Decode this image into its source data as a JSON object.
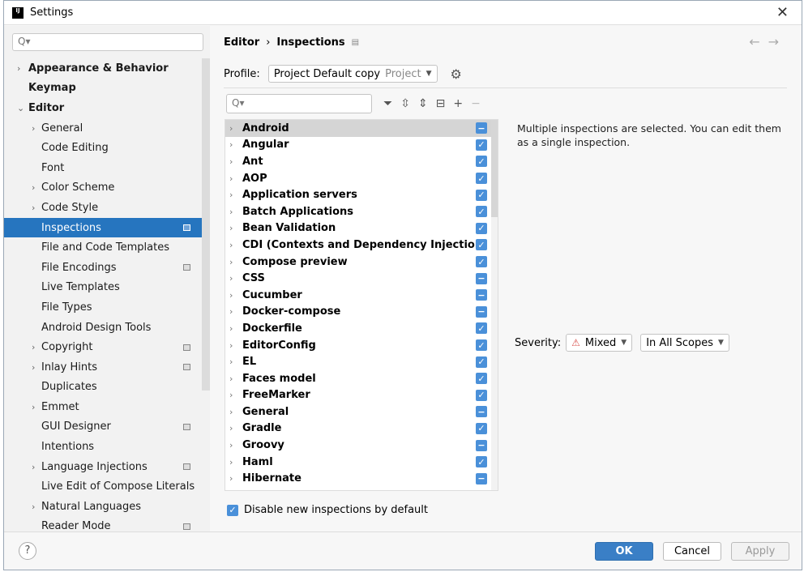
{
  "window": {
    "title": "Settings"
  },
  "sidebar": {
    "search_placeholder": "Q▾",
    "items": [
      {
        "label": "Appearance & Behavior",
        "level": 0,
        "arrow": "›",
        "bold": true
      },
      {
        "label": "Keymap",
        "level": 0,
        "arrow": "",
        "bold": true
      },
      {
        "label": "Editor",
        "level": 0,
        "arrow": "⌄",
        "bold": true
      },
      {
        "label": "General",
        "level": 1,
        "arrow": "›"
      },
      {
        "label": "Code Editing",
        "level": 1,
        "arrow": ""
      },
      {
        "label": "Font",
        "level": 1,
        "arrow": ""
      },
      {
        "label": "Color Scheme",
        "level": 1,
        "arrow": "›"
      },
      {
        "label": "Code Style",
        "level": 1,
        "arrow": "›"
      },
      {
        "label": "Inspections",
        "level": 1,
        "arrow": "",
        "selected": true,
        "cfg": true
      },
      {
        "label": "File and Code Templates",
        "level": 1,
        "arrow": ""
      },
      {
        "label": "File Encodings",
        "level": 1,
        "arrow": "",
        "cfg": true
      },
      {
        "label": "Live Templates",
        "level": 1,
        "arrow": ""
      },
      {
        "label": "File Types",
        "level": 1,
        "arrow": ""
      },
      {
        "label": "Android Design Tools",
        "level": 1,
        "arrow": ""
      },
      {
        "label": "Copyright",
        "level": 1,
        "arrow": "›",
        "cfg": true
      },
      {
        "label": "Inlay Hints",
        "level": 1,
        "arrow": "›",
        "cfg": true
      },
      {
        "label": "Duplicates",
        "level": 1,
        "arrow": ""
      },
      {
        "label": "Emmet",
        "level": 1,
        "arrow": "›"
      },
      {
        "label": "GUI Designer",
        "level": 1,
        "arrow": "",
        "cfg": true
      },
      {
        "label": "Intentions",
        "level": 1,
        "arrow": ""
      },
      {
        "label": "Language Injections",
        "level": 1,
        "arrow": "›",
        "cfg": true
      },
      {
        "label": "Live Edit of Compose Literals",
        "level": 1,
        "arrow": ""
      },
      {
        "label": "Natural Languages",
        "level": 1,
        "arrow": "›"
      },
      {
        "label": "Reader Mode",
        "level": 1,
        "arrow": "",
        "cfg": true
      }
    ]
  },
  "breadcrumb": [
    "Editor",
    "Inspections"
  ],
  "profile": {
    "label": "Profile:",
    "value": "Project Default copy",
    "scope": "Project"
  },
  "inspections": [
    {
      "name": "Android",
      "state": "mixed"
    },
    {
      "name": "Angular",
      "state": "checked"
    },
    {
      "name": "Ant",
      "state": "checked"
    },
    {
      "name": "AOP",
      "state": "checked"
    },
    {
      "name": "Application servers",
      "state": "checked"
    },
    {
      "name": "Batch Applications",
      "state": "checked"
    },
    {
      "name": "Bean Validation",
      "state": "checked"
    },
    {
      "name": "CDI (Contexts and Dependency Injection)",
      "state": "checked"
    },
    {
      "name": "Compose preview",
      "state": "checked"
    },
    {
      "name": "CSS",
      "state": "mixed"
    },
    {
      "name": "Cucumber",
      "state": "mixed"
    },
    {
      "name": "Docker-compose",
      "state": "mixed"
    },
    {
      "name": "Dockerfile",
      "state": "checked"
    },
    {
      "name": "EditorConfig",
      "state": "checked"
    },
    {
      "name": "EL",
      "state": "checked"
    },
    {
      "name": "Faces model",
      "state": "checked"
    },
    {
      "name": "FreeMarker",
      "state": "checked"
    },
    {
      "name": "General",
      "state": "mixed"
    },
    {
      "name": "Gradle",
      "state": "checked"
    },
    {
      "name": "Groovy",
      "state": "mixed"
    },
    {
      "name": "Haml",
      "state": "checked"
    },
    {
      "name": "Hibernate",
      "state": "mixed"
    }
  ],
  "description": "Multiple inspections are selected. You can edit them as a single inspection.",
  "severity": {
    "label": "Severity:",
    "value": "Mixed",
    "scope": "In All Scopes"
  },
  "disable_new": {
    "label": "Disable new inspections by default",
    "checked": true
  },
  "footer": {
    "help": "?",
    "ok": "OK",
    "cancel": "Cancel",
    "apply": "Apply"
  }
}
